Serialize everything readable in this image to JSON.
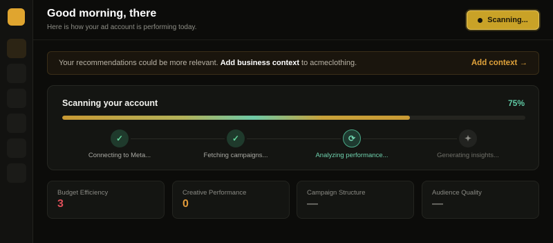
{
  "header": {
    "title": "Good morning, there",
    "subtitle": "Here is how your ad account is performing today.",
    "scan_button_label": "Scanning..."
  },
  "banner": {
    "text_before": "Your recommendations could be more relevant.",
    "highlight": "Add business context",
    "text_after": "to acmeclothing.",
    "link_label": "Add context →"
  },
  "scan": {
    "title": "Scanning your account",
    "percent_label": "75%",
    "progress": 0.75,
    "steps": [
      {
        "label": "Connecting to Meta...",
        "state": "done",
        "icon": "check-icon",
        "glyph": "✓"
      },
      {
        "label": "Fetching campaigns...",
        "state": "done",
        "icon": "check-icon",
        "glyph": "✓"
      },
      {
        "label": "Analyzing performance...",
        "state": "active",
        "icon": "refresh-icon",
        "glyph": "⟳"
      },
      {
        "label": "Generating insights...",
        "state": "pending",
        "icon": "sparkle-icon",
        "glyph": "✦"
      }
    ]
  },
  "metrics": [
    {
      "label": "Budget Efficiency",
      "value": "3",
      "color": "#e0505a"
    },
    {
      "label": "Creative Performance",
      "value": "0",
      "color": "#e09a3a"
    },
    {
      "label": "Campaign Structure",
      "value": "—",
      "color": "#7a7a74"
    },
    {
      "label": "Audience Quality",
      "value": "—",
      "color": "#7a7a74"
    }
  ],
  "colors": {
    "accent": "#e0a52f",
    "success": "#5fc9a4",
    "background": "#0c0c0a"
  }
}
